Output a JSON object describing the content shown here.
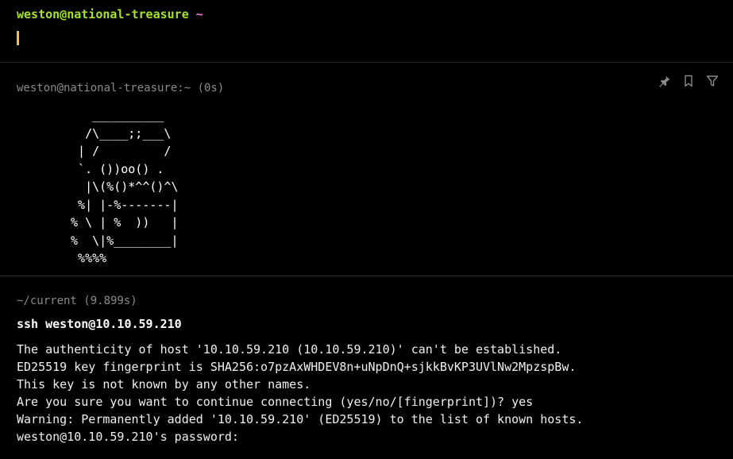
{
  "prompt": {
    "user_host": "weston@national-treasure",
    "cwd": "~"
  },
  "blocks": [
    {
      "header": "weston@national-treasure:~ (0s)",
      "actions": [
        "pin-icon",
        "bookmark-icon",
        "filter-icon"
      ],
      "ascii_art": [
        "    __________",
        "   /\\____;;___\\",
        "  | /         /",
        "  `. ())oo() .",
        "   |\\(%()*^^()^\\",
        "  %| |-%-------|",
        " % \\ | %  ))   |",
        " %  \\|%________|",
        "  %%%%"
      ]
    },
    {
      "header": "~/current (9.899s)",
      "command": "ssh weston@10.10.59.210",
      "output": [
        "The authenticity of host '10.10.59.210 (10.10.59.210)' can't be established.",
        "ED25519 key fingerprint is SHA256:o7pzAxWHDEV8n+uNpDnQ+sjkkBvKP3UVlNw2MpzspBw.",
        "This key is not known by any other names.",
        "Are you sure you want to continue connecting (yes/no/[fingerprint])? yes",
        "Warning: Permanently added '10.10.59.210' (ED25519) to the list of known hosts.",
        "weston@10.10.59.210's password:"
      ]
    }
  ],
  "colors": {
    "background": "#000000",
    "prompt_user": "#a6e22e",
    "prompt_cwd": "#e080d0",
    "cursor": "#f2c14e",
    "muted": "#8a8a8a"
  }
}
